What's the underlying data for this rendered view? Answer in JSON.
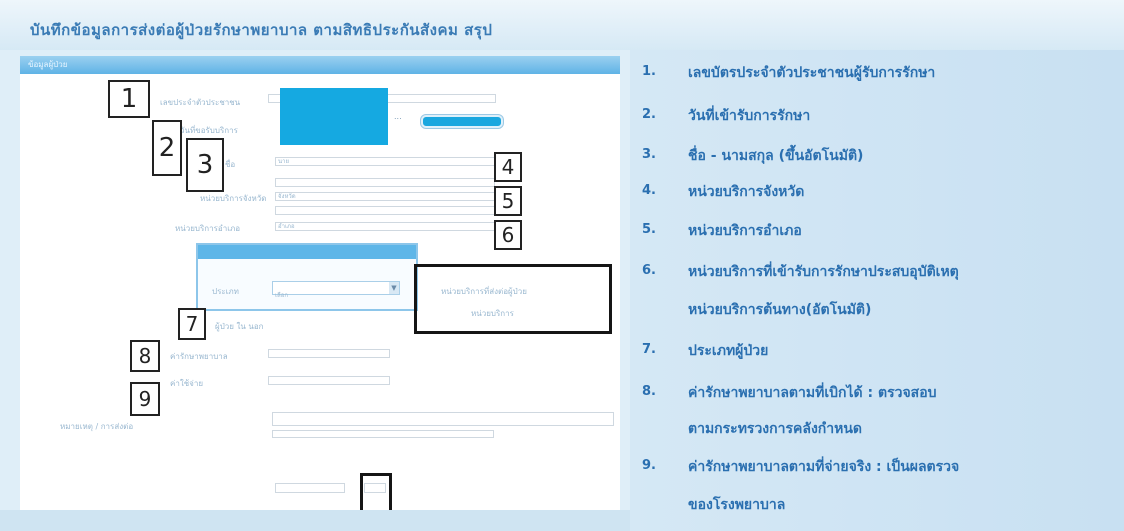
{
  "title": "บันทึกข้อมูลการส่งต่อผู้ป่วยรักษาพยาบาล ตามสิทธิประกันสังคม สรุป",
  "form": {
    "header_label": "ข้อมูลผู้ป่วย",
    "labels": {
      "pid": "เลขประจำตัวประชาชน",
      "card": "วันที่ขอรับบริการ",
      "name": "ชื่อ",
      "province": "หน่วยบริการจังหวัด",
      "district": "หน่วยบริการอำเภอ",
      "type": "ประเภท",
      "cost1": "ค่ารักษาพยาบาล",
      "cost2": "ค่าใช้จ่าย",
      "note": "หมายเหตุ / การส่งต่อ"
    },
    "values": {
      "name": "นาย",
      "province": "จังหวัด",
      "district": "อำเภอ",
      "type_select": "เลือก",
      "radio": "ผู้ป่วย   ใน   นอก"
    },
    "panel_text_1": "หน่วยบริการที่ส่งต่อผู้ป่วย",
    "panel_text_2": "หน่วยบริการ"
  },
  "markers": [
    "1",
    "2",
    "3",
    "4",
    "5",
    "6",
    "7",
    "8",
    "9"
  ],
  "list": [
    {
      "num": "1.",
      "lines": [
        "เลขบัตรประจำตัวประชาชนผู้รับการรักษา"
      ]
    },
    {
      "num": "2.",
      "lines": [
        "วันที่เข้ารับการรักษา"
      ]
    },
    {
      "num": "3.",
      "lines": [
        "ชื่อ - นามสกุล (ขึ้นอัตโนมัติ)"
      ]
    },
    {
      "num": "4.",
      "lines": [
        "หน่วยบริการจังหวัด"
      ]
    },
    {
      "num": "5.",
      "lines": [
        "หน่วยบริการอำเภอ"
      ]
    },
    {
      "num": "6.",
      "lines": [
        "หน่วยบริการที่เข้ารับการรักษาประสบอุบัติเหตุ",
        "หน่วยบริการต้นทาง(อัตโนมัติ)"
      ]
    },
    {
      "num": "7.",
      "lines": [
        "ประเภทผู้ป่วย"
      ]
    },
    {
      "num": "8.",
      "lines": [
        "ค่ารักษาพยาบาลตามที่เบิกได้ : ตรวจสอบ",
        "ตามกระทรวงการคลังกำหนด"
      ]
    },
    {
      "num": "9.",
      "lines": [
        "ค่ารักษาพยาบาลตามที่จ่ายจริง : เป็นผลตรวจ",
        "ของโรงพยาบาล"
      ]
    }
  ]
}
